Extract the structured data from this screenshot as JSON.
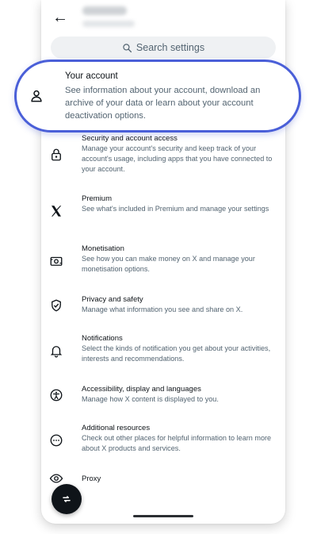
{
  "search": {
    "placeholder": "Search settings"
  },
  "account": {
    "title": "Your account",
    "description": "See information about your account, download an archive of your data or learn about your account deactivation options."
  },
  "items": [
    {
      "title": "Security and account access",
      "description": "Manage your account's security and keep track of your account's usage, including apps that you have connected to your account.",
      "icon": "lock-icon"
    },
    {
      "title": "Premium",
      "description": "See what's included in Premium and manage your settings",
      "icon": "x-logo-icon"
    },
    {
      "title": "Monetisation",
      "description": "See how you can make money on X and manage your monetisation options.",
      "icon": "money-icon"
    },
    {
      "title": "Privacy and safety",
      "description": "Manage what information you see and share on X.",
      "icon": "shield-icon"
    },
    {
      "title": "Notifications",
      "description": "Select the kinds of notification you get about your activities, interests and recommendations.",
      "icon": "bell-icon"
    },
    {
      "title": "Accessibility, display and languages",
      "description": "Manage how X content is displayed to you.",
      "icon": "accessibility-icon"
    },
    {
      "title": "Additional resources",
      "description": "Check out other places for helpful information to learn more about X products and services.",
      "icon": "more-icon"
    },
    {
      "title": "Proxy",
      "description": "",
      "icon": "proxy-icon"
    }
  ]
}
